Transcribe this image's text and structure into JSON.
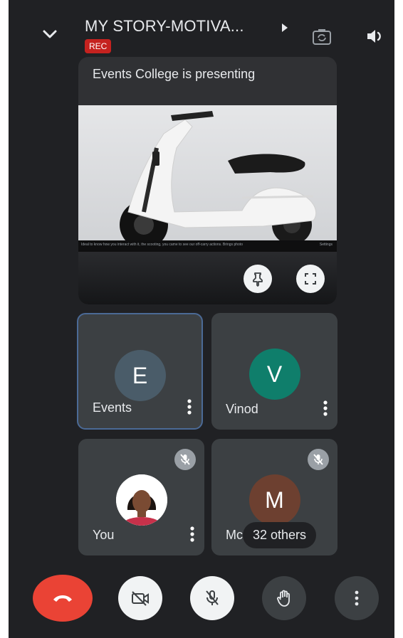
{
  "header": {
    "title": "MY STORY-MOTIVA...",
    "rec_badge": "REC"
  },
  "presentation": {
    "label": "Events College is presenting",
    "caption_left": "Ideal to know how you interact with it, the scooting, you came to see our off-carry actions. Brings photo",
    "caption_right": "Settings"
  },
  "participants": [
    {
      "initial": "E",
      "name": "Events",
      "avatar_color": "#4a5c69",
      "muted": false
    },
    {
      "initial": "V",
      "name": "Vinod",
      "avatar_color": "#0f7e6b",
      "muted": false
    },
    {
      "initial": "",
      "name": "You",
      "avatar_color": "#ffffff",
      "muted": true
    },
    {
      "initial": "M",
      "name": "Mc",
      "avatar_color": "#6d4030",
      "muted": true,
      "others_label": "32 others"
    }
  ],
  "controls": [
    "end-call",
    "camera-off",
    "mic-off",
    "raise-hand",
    "more-options"
  ],
  "colors": {
    "background": "#202124",
    "tile": "#3c4043",
    "end_call": "#ea4335",
    "rec": "#c5221f"
  }
}
